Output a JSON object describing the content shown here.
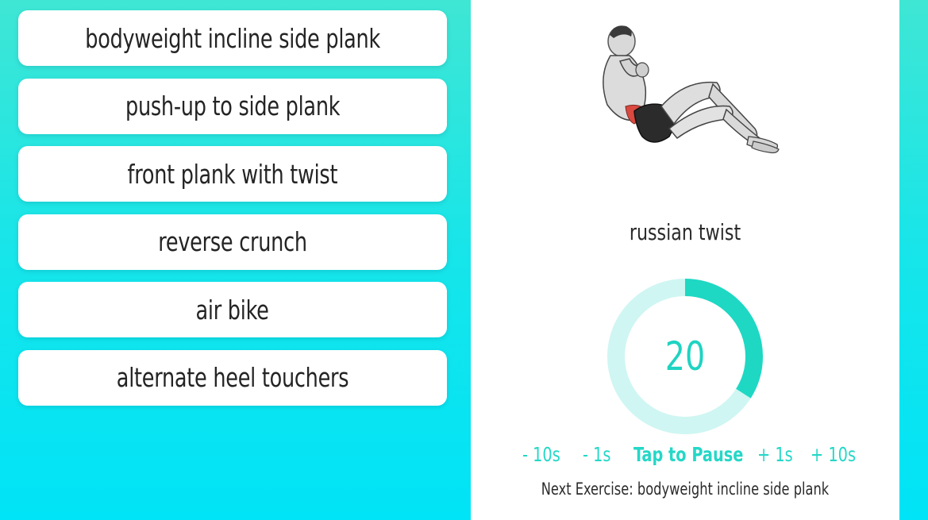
{
  "exercise_list": [
    {
      "label": "bodyweight incline side plank"
    },
    {
      "label": "push-up to side plank"
    },
    {
      "label": "front plank with twist"
    },
    {
      "label": "reverse crunch"
    },
    {
      "label": "air bike"
    },
    {
      "label": "alternate heel touchers"
    }
  ],
  "current": {
    "name": "russian twist",
    "illustration_icon": "russian-twist-figure",
    "timer_value": "20",
    "timer_progress_fraction": 0.66
  },
  "controls": {
    "minus_10": "- 10s",
    "minus_1": "- 1s",
    "pause": "Tap to Pause",
    "plus_1": "+ 1s",
    "plus_10": "+ 10s"
  },
  "next": {
    "text": "Next Exercise: bodyweight incline side plank"
  },
  "colors": {
    "accent": "#1ed8c3",
    "ring_track": "#cff6f2",
    "background_top": "#3fe6d4",
    "background_bottom": "#00e4f7"
  }
}
